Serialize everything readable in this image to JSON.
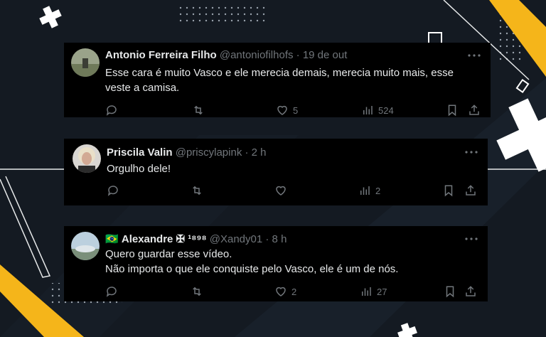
{
  "colors": {
    "background": "#141a22",
    "card": "#000000",
    "accent_yellow": "#f5b51a",
    "text_primary": "#e7e9ea",
    "text_secondary": "#71767b"
  },
  "tweets": [
    {
      "name": "Antonio Ferreira Filho",
      "handle": "@antoniofilhofs",
      "time": "· 19 de out",
      "lines": [
        "Esse cara é muito Vasco e ele merecia demais, merecia muito mais, esse",
        "veste a camisa."
      ],
      "replies": "",
      "retweets": "",
      "likes": "5",
      "views": "524"
    },
    {
      "name": "Priscila Valin",
      "handle": "@priscylapink",
      "time": "· 2 h",
      "lines": [
        "Orgulho dele!"
      ],
      "replies": "",
      "retweets": "",
      "likes": "",
      "views": "2"
    },
    {
      "flag": "🇧🇷",
      "name": "Alexandre ✠ ¹⁸⁹⁸",
      "handle": "@Xandy01",
      "time": "· 8 h",
      "lines": [
        "Quero guardar esse vídeo.",
        "Não importa o que ele conquiste pelo Vasco, ele é um de nós."
      ],
      "replies": "",
      "retweets": "",
      "likes": "2",
      "views": "27"
    }
  ]
}
